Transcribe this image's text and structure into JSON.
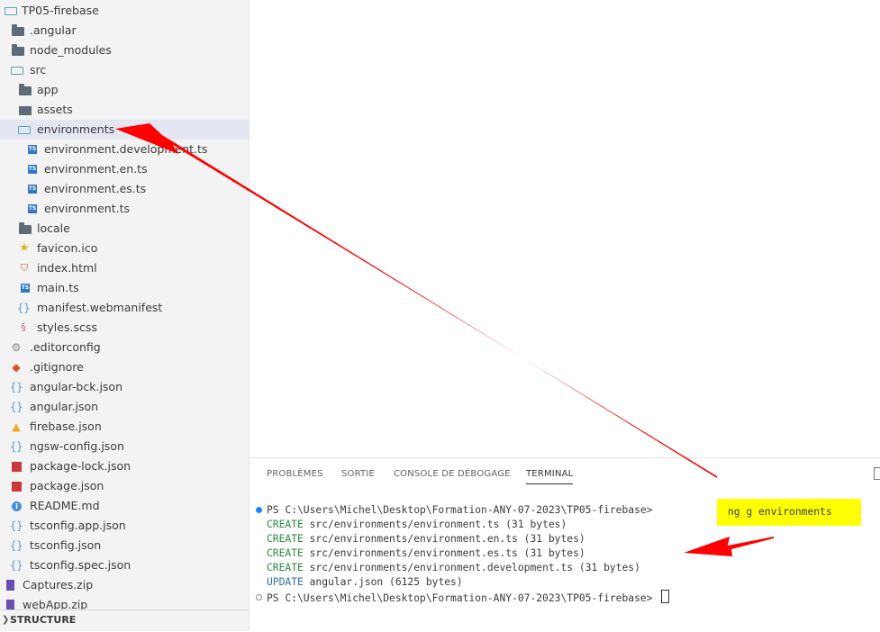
{
  "explorer": {
    "items": [
      {
        "label": "TP05-firebase",
        "icon": "folder-open-icon"
      },
      {
        "label": ".angular",
        "icon": "folder-icon"
      },
      {
        "label": "node_modules",
        "icon": "folder-icon"
      },
      {
        "label": "src",
        "icon": "folder-open-icon"
      },
      {
        "label": "app",
        "icon": "folder-icon"
      },
      {
        "label": "assets",
        "icon": "folder-icon"
      },
      {
        "label": "environments",
        "icon": "folder-open-icon"
      },
      {
        "label": "environment.development.ts",
        "icon": "typescript-icon"
      },
      {
        "label": "environment.en.ts",
        "icon": "typescript-icon"
      },
      {
        "label": "environment.es.ts",
        "icon": "typescript-icon"
      },
      {
        "label": "environment.ts",
        "icon": "typescript-icon"
      },
      {
        "label": "locale",
        "icon": "folder-icon"
      },
      {
        "label": "favicon.ico",
        "icon": "star-icon"
      },
      {
        "label": "index.html",
        "icon": "html-icon"
      },
      {
        "label": "main.ts",
        "icon": "typescript-icon"
      },
      {
        "label": "manifest.webmanifest",
        "icon": "json-icon"
      },
      {
        "label": "styles.scss",
        "icon": "sass-icon"
      },
      {
        "label": ".editorconfig",
        "icon": "gear-icon"
      },
      {
        "label": ".gitignore",
        "icon": "git-icon"
      },
      {
        "label": "angular-bck.json",
        "icon": "json-icon"
      },
      {
        "label": "angular.json",
        "icon": "json-icon"
      },
      {
        "label": "firebase.json",
        "icon": "firebase-icon"
      },
      {
        "label": "ngsw-config.json",
        "icon": "json-icon"
      },
      {
        "label": "package-lock.json",
        "icon": "npm-icon"
      },
      {
        "label": "package.json",
        "icon": "npm-icon"
      },
      {
        "label": "README.md",
        "icon": "info-icon"
      },
      {
        "label": "tsconfig.app.json",
        "icon": "json-icon"
      },
      {
        "label": "tsconfig.json",
        "icon": "json-icon"
      },
      {
        "label": "tsconfig.spec.json",
        "icon": "json-icon"
      },
      {
        "label": "Captures.zip",
        "icon": "zip-icon"
      },
      {
        "label": "webApp.zip",
        "icon": "zip-icon"
      }
    ],
    "structure_label": "STRUCTURE"
  },
  "panel": {
    "tabs": [
      "PROBLÈMES",
      "SORTIE",
      "CONSOLE DE DÉBOGAGE",
      "TERMINAL"
    ],
    "active_tab": "TERMINAL"
  },
  "terminal": {
    "prompt1": "PS C:\\Users\\Michel\\Desktop\\Formation-ANY-07-2023\\TP05-firebase> ",
    "command": "ng g environments",
    "lines": [
      {
        "action": "CREATE",
        "text": " src/environments/environment.ts (31 bytes)"
      },
      {
        "action": "CREATE",
        "text": " src/environments/environment.en.ts (31 bytes)"
      },
      {
        "action": "CREATE",
        "text": " src/environments/environment.es.ts (31 bytes)"
      },
      {
        "action": "CREATE",
        "text": " src/environments/environment.development.ts (31 bytes)"
      },
      {
        "action": "UPDATE",
        "text": " angular.json (6125 bytes)"
      }
    ],
    "prompt2": "PS C:\\Users\\Michel\\Desktop\\Formation-ANY-07-2023\\TP05-firebase> "
  },
  "colors": {
    "highlight": "#ffff00",
    "arrow": "#ff0000",
    "create": "#2b8a3e",
    "update": "#2e6fb3"
  }
}
